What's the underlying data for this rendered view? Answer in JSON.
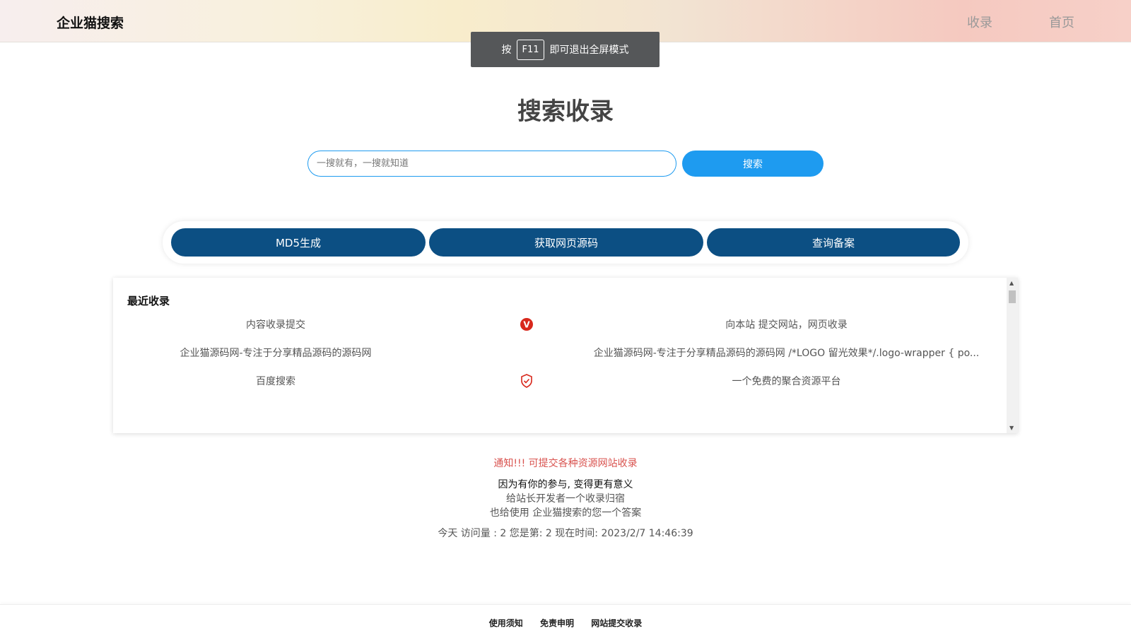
{
  "header": {
    "logo": "企业猫搜索",
    "nav": [
      "收录",
      "首页"
    ]
  },
  "toast": {
    "prefix": "按",
    "key": "F11",
    "suffix": "即可退出全屏模式"
  },
  "page_title": "搜索收录",
  "search": {
    "placeholder": "一搜就有，一搜就知道",
    "value": "",
    "button": "搜索"
  },
  "tools": [
    "MD5生成",
    "获取网页源码",
    "查询备案"
  ],
  "recent": {
    "title": "最近收录",
    "items": [
      {
        "name": "内容收录提交",
        "icon": "v-badge-icon",
        "desc": "向本站 提交网站，网页收录"
      },
      {
        "name": "企业猫源码网-专注于分享精品源码的源码网",
        "icon": "",
        "desc": "企业猫源码网-专注于分享精品源码的源码网 /*LOGO 留光效果*/.logo-wrapper { po..."
      },
      {
        "name": "百度搜索",
        "icon": "shield-check-icon",
        "desc": "一个免费的聚合资源平台"
      }
    ]
  },
  "notice": "通知!!! 可提交各种资源网站收录",
  "lines": [
    "因为有你的参与, 变得更有意义",
    "给站长开发者一个收录归宿",
    "也给使用 企业猫搜索的您一个答案"
  ],
  "stats": "今天 访问量 : 2 您是第: 2 现在时间: 2023/2/7 14:46:39",
  "footer": [
    "使用须知",
    "免责申明",
    "网站提交收录"
  ],
  "colors": {
    "accent": "#1e9bf0",
    "tool": "#0c4f83",
    "notice": "#d9534f"
  }
}
